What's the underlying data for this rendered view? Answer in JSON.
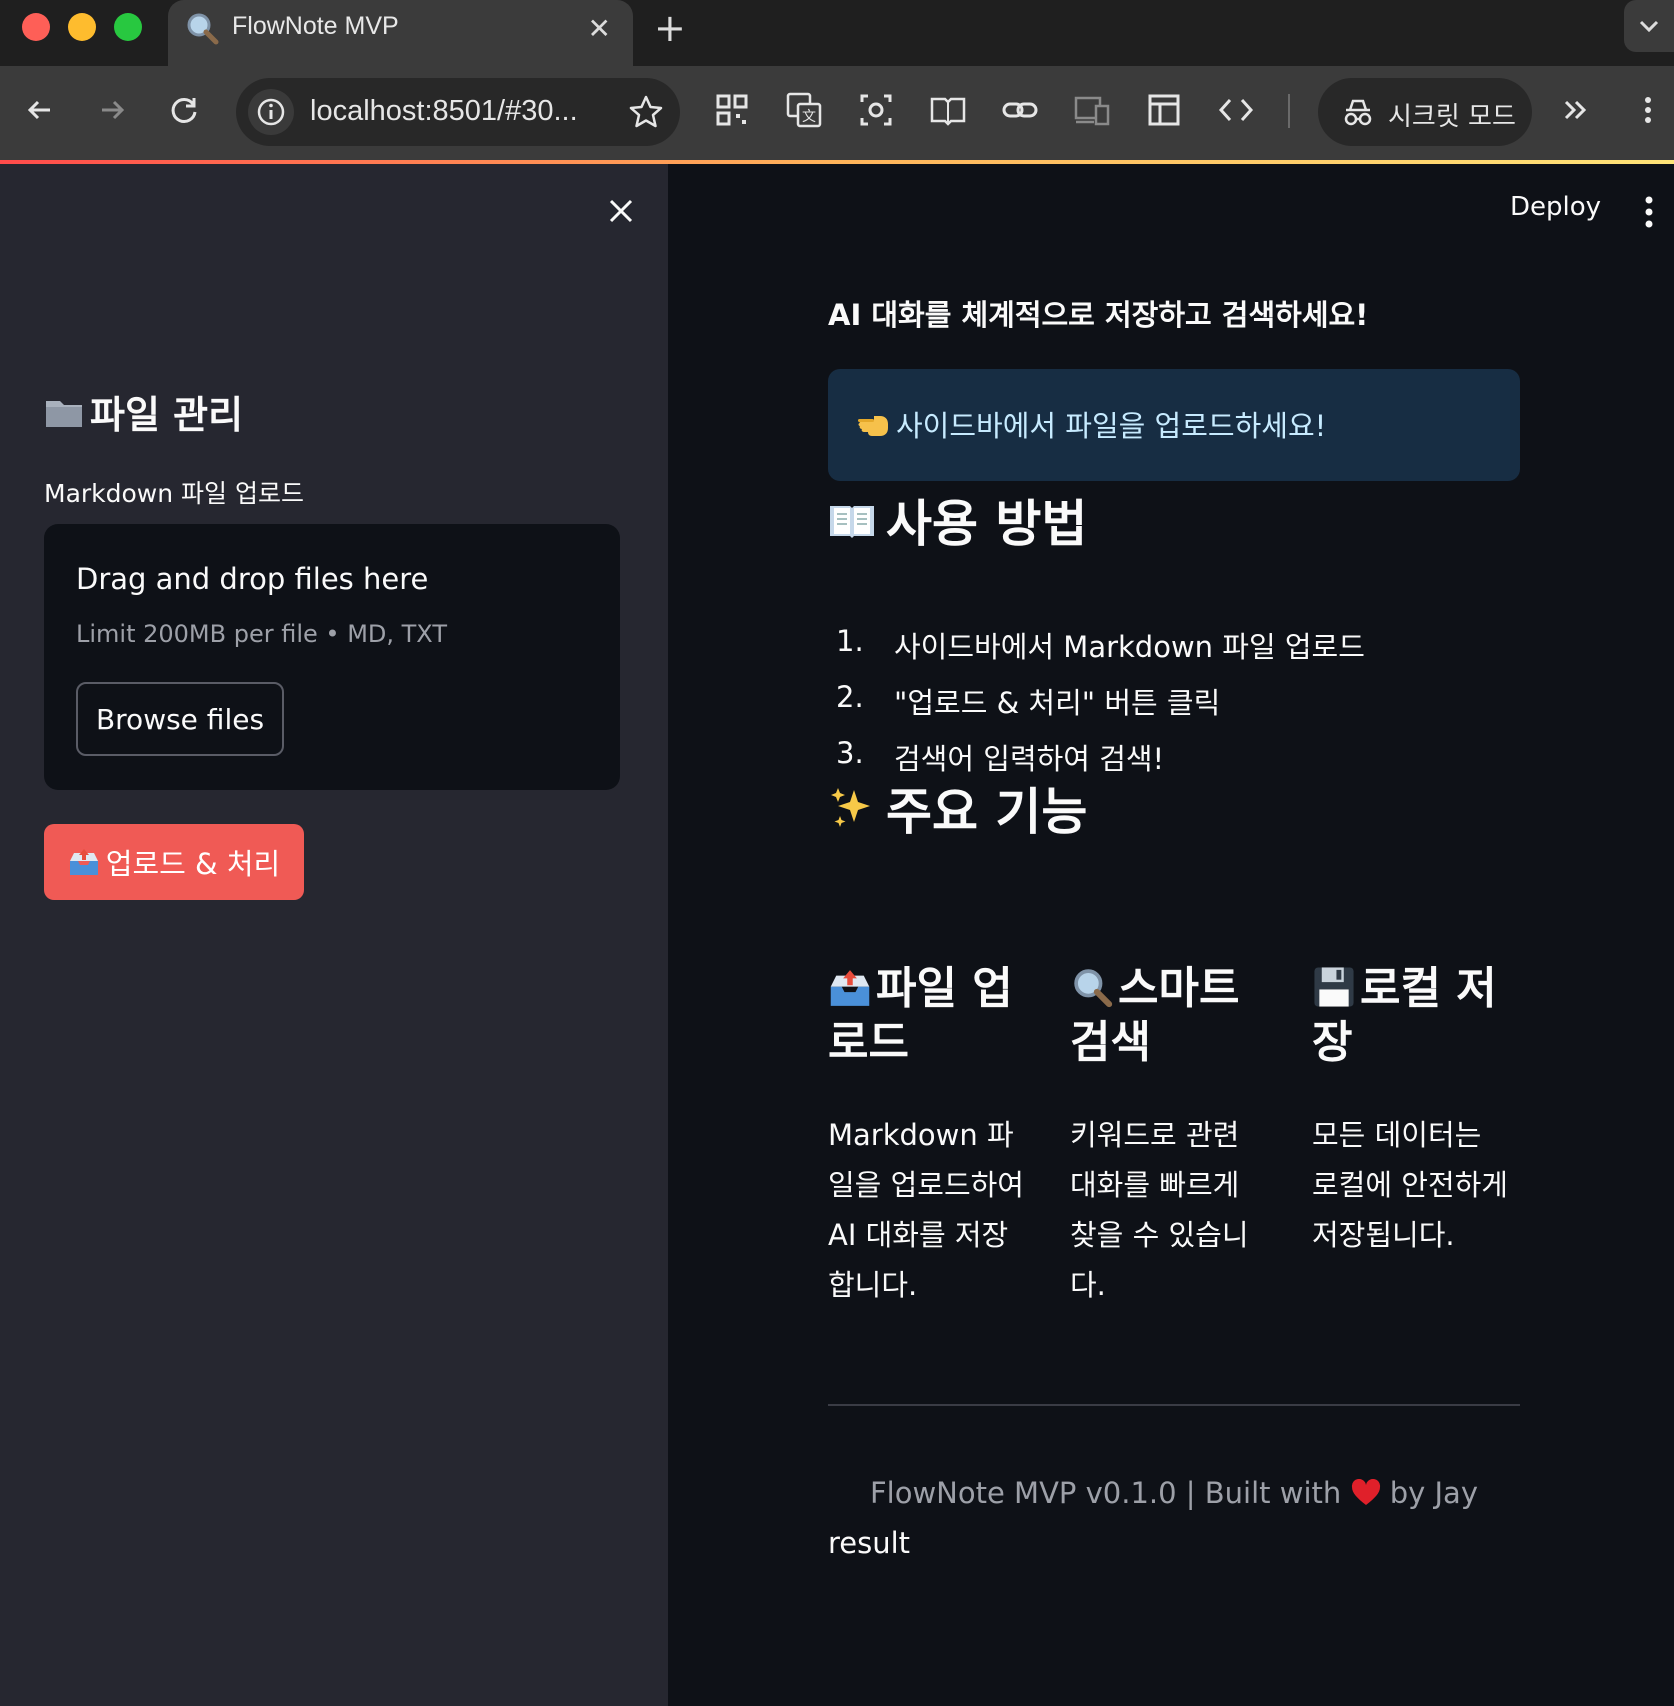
{
  "browser": {
    "tab_title": "FlowNote MVP",
    "url": "localhost:8501/#30...",
    "incognito_label": "시크릿 모드",
    "toolbar_icons": [
      "back-icon",
      "forward-icon",
      "reload-icon",
      "info-icon",
      "star-icon",
      "qr-code-icon",
      "translate-icon",
      "screenshot-icon",
      "reading-mode-icon",
      "link-icon",
      "devices-icon",
      "layout-icon",
      "code-icon",
      "incognito-icon",
      "extensions-chevron-icon",
      "menu-dots-icon"
    ]
  },
  "sidebar": {
    "title_icon": "folder-icon",
    "title": "파일 관리",
    "uploader_label": "Markdown 파일 업로드",
    "drop_title": "Drag and drop files here",
    "drop_limit": "Limit 200MB per file • MD, TXT",
    "browse_label": "Browse files",
    "process_icon": "outbox-tray-icon",
    "process_label": "업로드 & 처리"
  },
  "header": {
    "deploy_label": "Deploy"
  },
  "main": {
    "subtitle": "AI 대화를 체계적으로 저장하고 검색하세요!",
    "info_icon": "pointing-left-hand-icon",
    "info_text": "사이드바에서 파일을 업로드하세요!",
    "how_to_title": "사용 방법",
    "how_to_icon": "open-book-icon",
    "steps": [
      {
        "num": "1.",
        "text": "사이드바에서 Markdown 파일 업로드"
      },
      {
        "num": "2.",
        "text": "\"업로드 & 처리\" 버튼 클릭"
      },
      {
        "num": "3.",
        "text": "검색어 입력하여 검색!"
      }
    ],
    "features_title": "주요 기능",
    "features_icon": "sparkles-icon",
    "features": [
      {
        "icon": "outbox-tray-icon",
        "title": "파일 업로드",
        "desc": "Markdown 파일을 업로드하여 AI 대화를 저장합니다."
      },
      {
        "icon": "magnifier-icon",
        "title": "스마트 검색",
        "desc": "키워드로 관련 대화를 빠르게 찾을 수 있습니다."
      },
      {
        "icon": "floppy-disk-icon",
        "title": "로컬 저장",
        "desc": "모든 데이터는 로컬에 안전하게 저장됩니다."
      }
    ],
    "footer_pre": "FlowNote MVP v0.1.0 | Built with",
    "footer_icon": "heart-icon",
    "footer_post": "by Jay",
    "result_label": "result"
  },
  "colors": {
    "primary_button": "#f05a55",
    "info_bg": "#172d43",
    "sidebar_bg": "#262730",
    "main_bg": "#0e1117"
  }
}
